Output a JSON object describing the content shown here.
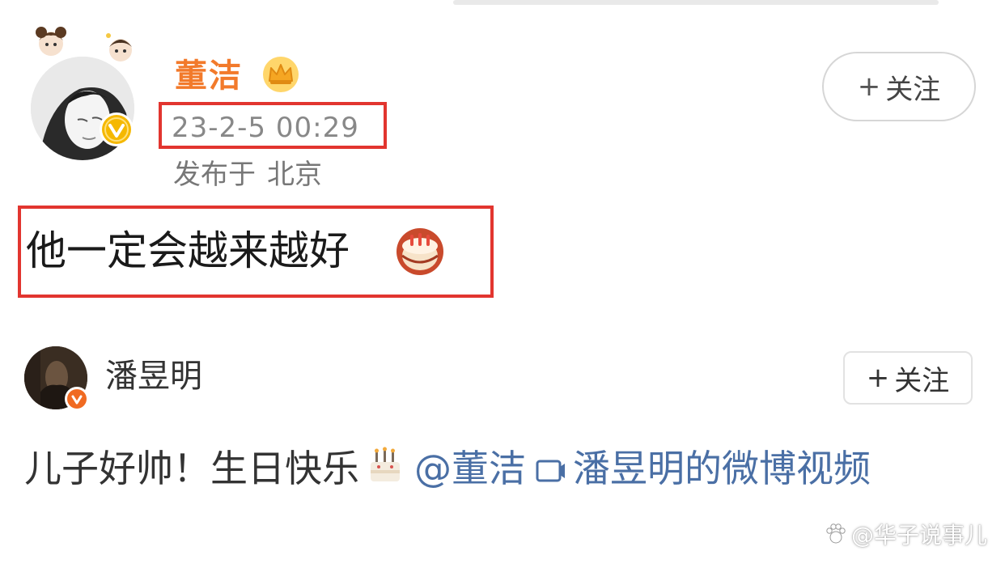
{
  "post1": {
    "author": "董洁",
    "time": "23-2-5 00:29",
    "location_prefix": "发布于",
    "location_city": "北京",
    "follow_plus": "+",
    "follow_label": "关注",
    "text": "他一定会越来越好",
    "emoji_icon": "cake-emoji-icon"
  },
  "post2": {
    "author": "潘昱明",
    "follow_plus": "+",
    "follow_label": "关注",
    "text": "儿子好帅！生日快乐",
    "mention": "@董洁",
    "video_link": "潘昱明的微博视频"
  },
  "watermark": "@华子说事儿",
  "colors": {
    "highlight_border": "#e2352f",
    "author_vip_name": "#f27a2b",
    "link": "#4a6fa5"
  }
}
